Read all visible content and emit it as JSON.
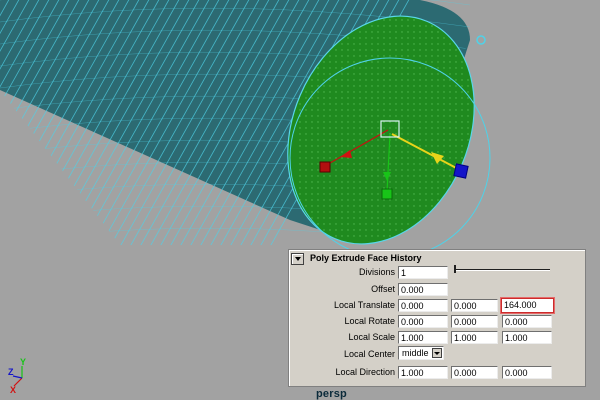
{
  "viewport": {
    "panel_name": "persp",
    "axis_labels": {
      "x": "X",
      "y": "Y",
      "z": "Z"
    },
    "colors": {
      "background": "#a2a2a2",
      "wireframe": "#4fd2e8",
      "selected_face": "#1f8a1f",
      "cylinder_body": "#2c6a72",
      "manip_x": "#d11212",
      "manip_y": "#18c418",
      "manip_z": "#1414c8",
      "manip_handle": "#e8d41a"
    }
  },
  "history_panel": {
    "title": "Poly Extrude Face History",
    "collapse_icon": "triangle-down-icon",
    "divisions": {
      "label": "Divisions",
      "value": "1",
      "slider_fraction": 0.0
    },
    "offset": {
      "label": "Offset",
      "value": "0.000"
    },
    "local_translate": {
      "label": "Local Translate",
      "x": "0.000",
      "y": "0.000",
      "z": "164.000"
    },
    "local_rotate": {
      "label": "Local Rotate",
      "x": "0.000",
      "y": "0.000",
      "z": "0.000"
    },
    "local_scale": {
      "label": "Local Scale",
      "x": "1.000",
      "y": "1.000",
      "z": "1.000"
    },
    "local_center": {
      "label": "Local Center",
      "value": "middle"
    },
    "local_direction": {
      "label": "Local Direction",
      "x": "1.000",
      "y": "0.000",
      "z": "0.000"
    }
  }
}
